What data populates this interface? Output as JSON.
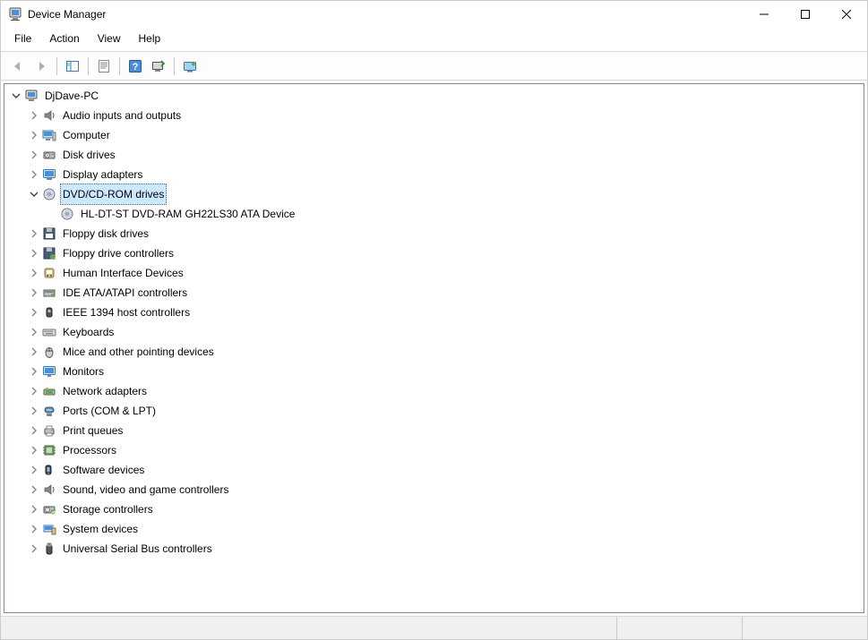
{
  "window": {
    "title": "Device Manager"
  },
  "menu": {
    "file": "File",
    "action": "Action",
    "view": "View",
    "help": "Help"
  },
  "tree": {
    "root": {
      "label": "DjDave-PC",
      "expanded": true
    },
    "categories": [
      {
        "key": "audio",
        "label": "Audio inputs and outputs",
        "icon": "audio",
        "expanded": false,
        "children": []
      },
      {
        "key": "computer",
        "label": "Computer",
        "icon": "computer",
        "expanded": false,
        "children": []
      },
      {
        "key": "disks",
        "label": "Disk drives",
        "icon": "disk",
        "expanded": false,
        "children": []
      },
      {
        "key": "display",
        "label": "Display adapters",
        "icon": "display",
        "expanded": false,
        "children": []
      },
      {
        "key": "dvd",
        "label": "DVD/CD-ROM drives",
        "icon": "optical",
        "expanded": true,
        "selected": true,
        "children": [
          {
            "label": "HL-DT-ST DVD-RAM GH22LS30 ATA Device",
            "icon": "optical"
          }
        ]
      },
      {
        "key": "floppy",
        "label": "Floppy disk drives",
        "icon": "floppy",
        "expanded": false,
        "children": []
      },
      {
        "key": "floppyctrl",
        "label": "Floppy drive controllers",
        "icon": "floppyctrl",
        "expanded": false,
        "children": []
      },
      {
        "key": "hid",
        "label": "Human Interface Devices",
        "icon": "hid",
        "expanded": false,
        "children": []
      },
      {
        "key": "ide",
        "label": "IDE ATA/ATAPI controllers",
        "icon": "ide",
        "expanded": false,
        "children": []
      },
      {
        "key": "ieee1394",
        "label": "IEEE 1394 host controllers",
        "icon": "firewire",
        "expanded": false,
        "children": []
      },
      {
        "key": "keyboards",
        "label": "Keyboards",
        "icon": "keyboard",
        "expanded": false,
        "children": []
      },
      {
        "key": "mice",
        "label": "Mice and other pointing devices",
        "icon": "mouse",
        "expanded": false,
        "children": []
      },
      {
        "key": "monitors",
        "label": "Monitors",
        "icon": "monitor",
        "expanded": false,
        "children": []
      },
      {
        "key": "network",
        "label": "Network adapters",
        "icon": "network",
        "expanded": false,
        "children": []
      },
      {
        "key": "ports",
        "label": "Ports (COM & LPT)",
        "icon": "port",
        "expanded": false,
        "children": []
      },
      {
        "key": "printq",
        "label": "Print queues",
        "icon": "printer",
        "expanded": false,
        "children": []
      },
      {
        "key": "processors",
        "label": "Processors",
        "icon": "cpu",
        "expanded": false,
        "children": []
      },
      {
        "key": "software",
        "label": "Software devices",
        "icon": "software",
        "expanded": false,
        "children": []
      },
      {
        "key": "sound",
        "label": "Sound, video and game controllers",
        "icon": "audio",
        "expanded": false,
        "children": []
      },
      {
        "key": "storage",
        "label": "Storage controllers",
        "icon": "storage",
        "expanded": false,
        "children": []
      },
      {
        "key": "system",
        "label": "System devices",
        "icon": "system",
        "expanded": false,
        "children": []
      },
      {
        "key": "usb",
        "label": "Universal Serial Bus controllers",
        "icon": "usb",
        "expanded": false,
        "children": []
      }
    ]
  }
}
